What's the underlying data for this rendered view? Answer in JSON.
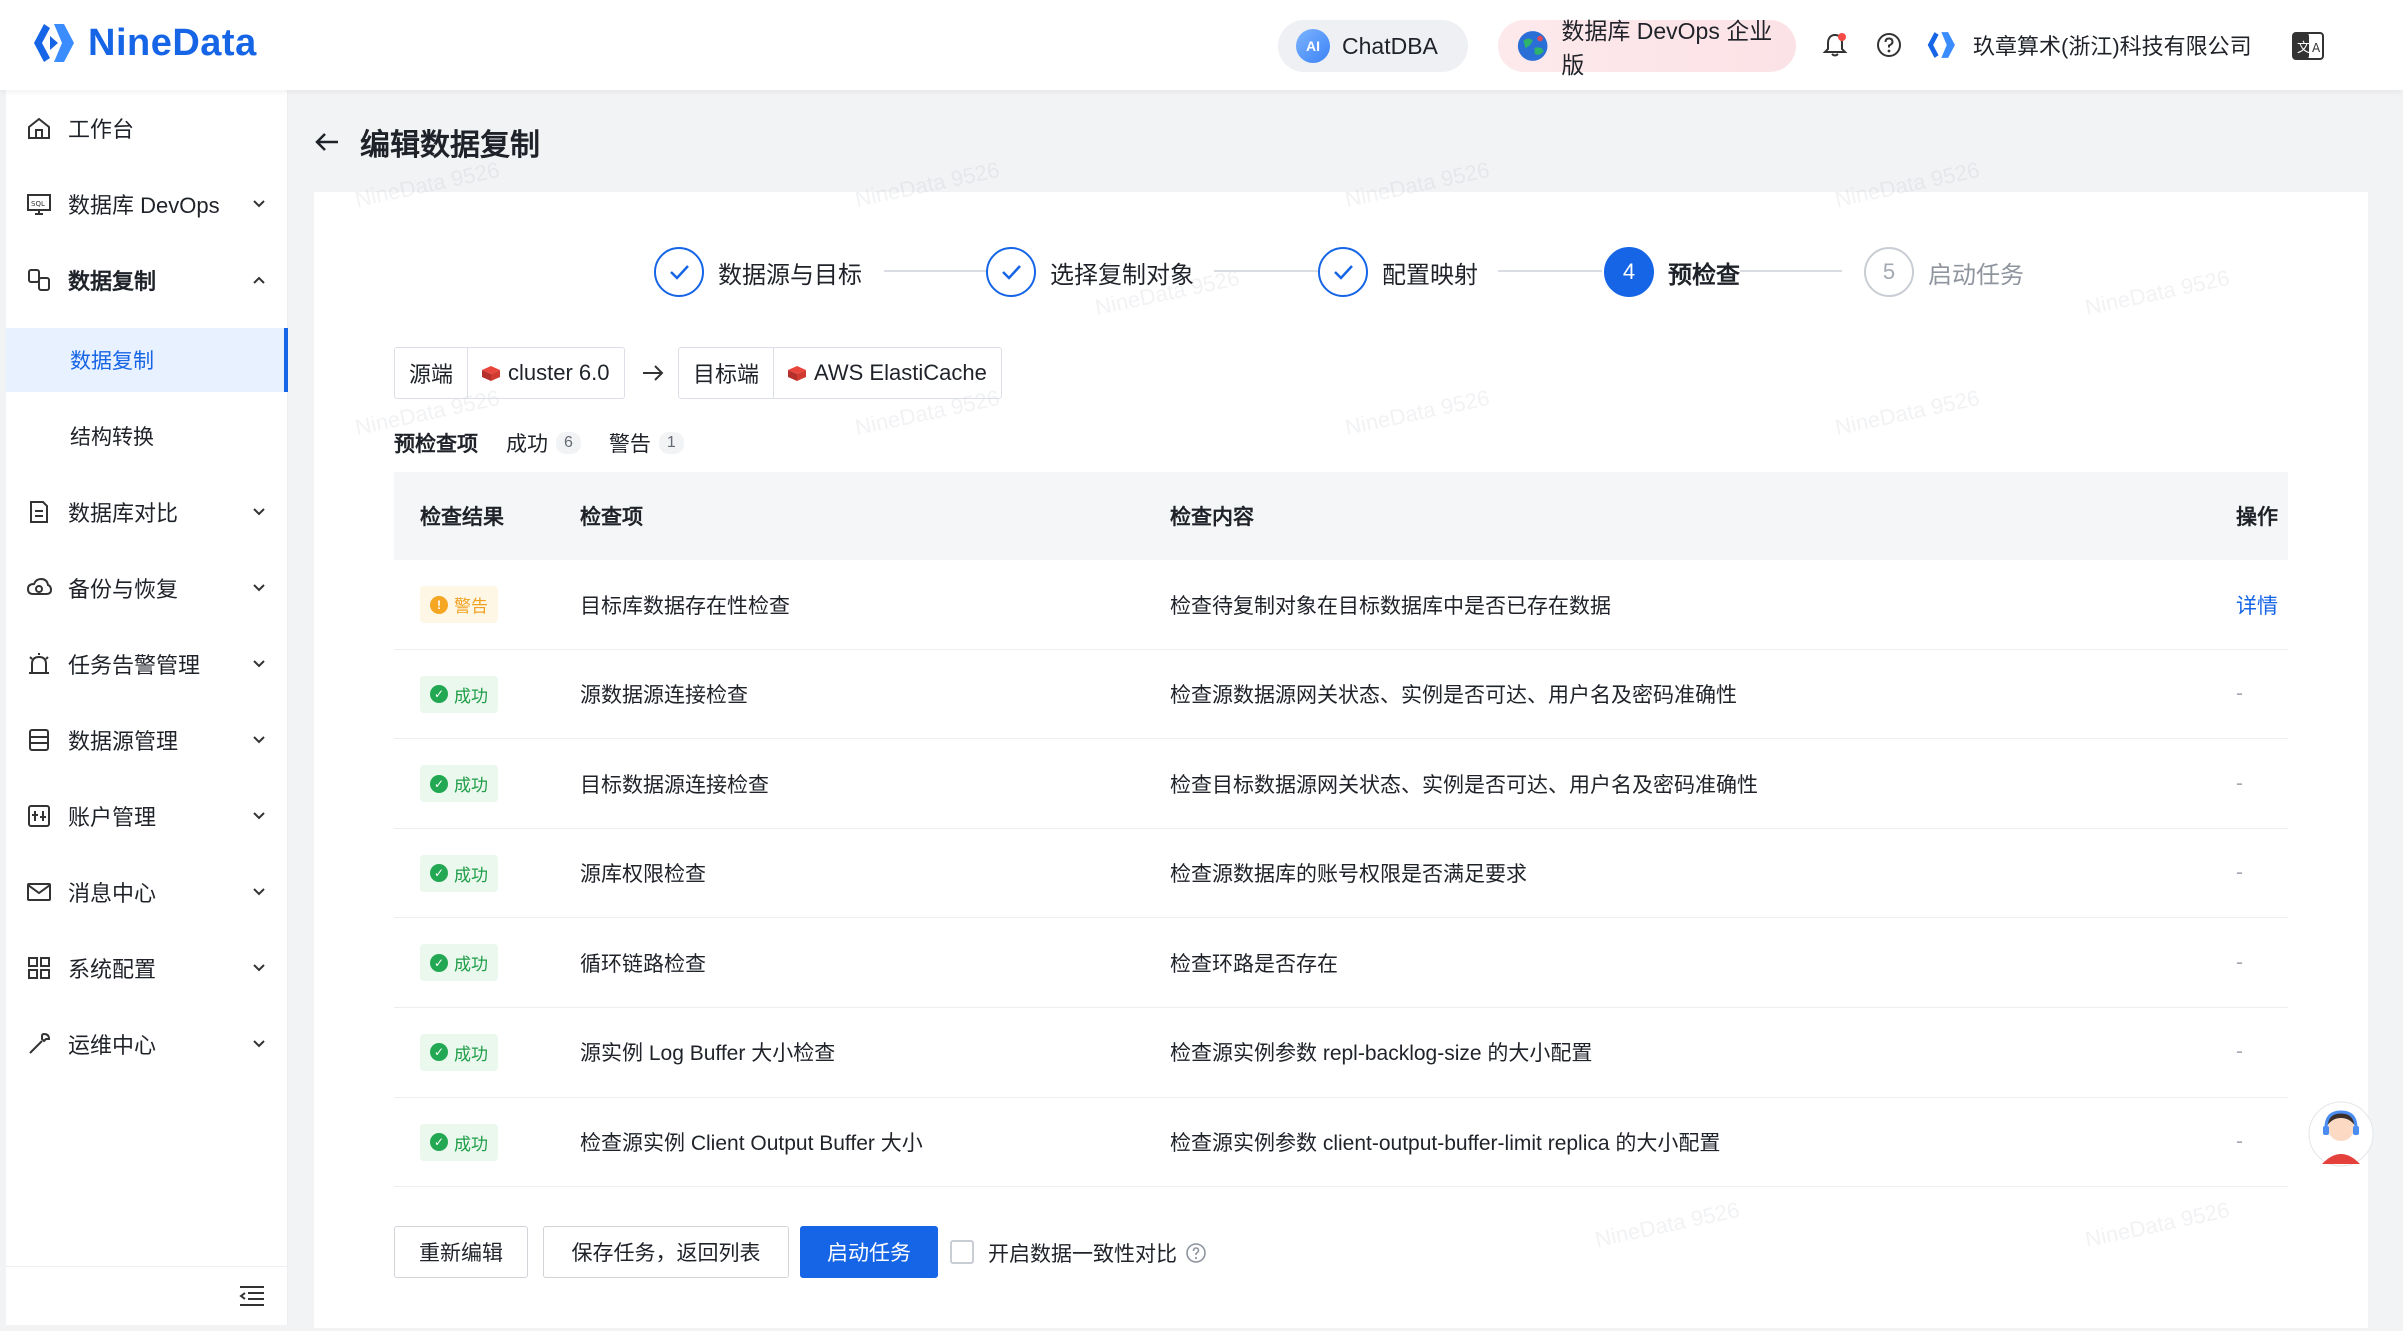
{
  "header": {
    "logo_text": "NineData",
    "chatdba_label": "ChatDBA",
    "chatdba_badge": "AI",
    "edition_label": "数据库 DevOps 企业版",
    "company_name": "玖章算术(浙江)科技有限公司",
    "icons": [
      "bell-icon",
      "help-icon",
      "company-logo-icon",
      "language-switch-icon"
    ]
  },
  "sidebar": {
    "items": [
      {
        "label": "工作台",
        "icon": "home-icon"
      },
      {
        "label": "数据库 DevOps",
        "icon": "sql-console-icon"
      },
      {
        "label": "数据复制",
        "icon": "replication-icon"
      },
      {
        "label": "数据库对比",
        "icon": "compare-icon"
      },
      {
        "label": "备份与恢复",
        "icon": "cloud-backup-icon"
      },
      {
        "label": "任务告警管理",
        "icon": "alarm-icon"
      },
      {
        "label": "数据源管理",
        "icon": "datasource-icon"
      },
      {
        "label": "账户管理",
        "icon": "account-icon"
      },
      {
        "label": "消息中心",
        "icon": "mail-icon"
      },
      {
        "label": "系统配置",
        "icon": "grid-icon"
      },
      {
        "label": "运维中心",
        "icon": "wrench-icon"
      }
    ],
    "sub_items": [
      {
        "label": "数据复制",
        "active": true
      },
      {
        "label": "结构转换",
        "active": false
      }
    ]
  },
  "page": {
    "title": "编辑数据复制",
    "steps": [
      {
        "label": "数据源与目标",
        "state": "done",
        "number": ""
      },
      {
        "label": "选择复制对象",
        "state": "done",
        "number": ""
      },
      {
        "label": "配置映射",
        "state": "done",
        "number": ""
      },
      {
        "label": "预检查",
        "state": "current",
        "number": "4"
      },
      {
        "label": "启动任务",
        "state": "pending",
        "number": "5"
      }
    ],
    "source": {
      "tag": "源端",
      "value": "cluster 6.0"
    },
    "target": {
      "tag": "目标端",
      "value": "AWS ElastiCache"
    },
    "filters": [
      {
        "label": "预检查项",
        "count": ""
      },
      {
        "label": "成功",
        "count": "6"
      },
      {
        "label": "警告",
        "count": "1"
      }
    ],
    "table": {
      "headers": [
        "检查结果",
        "检查项",
        "检查内容",
        "操作"
      ],
      "rows": [
        {
          "status": "警告",
          "status_type": "warn",
          "item": "目标库数据存在性检查",
          "content": "检查待复制对象在目标数据库中是否已存在数据",
          "op": "详情"
        },
        {
          "status": "成功",
          "status_type": "ok",
          "item": "源数据源连接检查",
          "content": "检查源数据源网关状态、实例是否可达、用户名及密码准确性",
          "op": "-"
        },
        {
          "status": "成功",
          "status_type": "ok",
          "item": "目标数据源连接检查",
          "content": "检查目标数据源网关状态、实例是否可达、用户名及密码准确性",
          "op": "-"
        },
        {
          "status": "成功",
          "status_type": "ok",
          "item": "源库权限检查",
          "content": "检查源数据库的账号权限是否满足要求",
          "op": "-"
        },
        {
          "status": "成功",
          "status_type": "ok",
          "item": "循环链路检查",
          "content": "检查环路是否存在",
          "op": "-"
        },
        {
          "status": "成功",
          "status_type": "ok",
          "item": "源实例 Log Buffer 大小检查",
          "content": "检查源实例参数 repl-backlog-size 的大小配置",
          "op": "-"
        },
        {
          "status": "成功",
          "status_type": "ok",
          "item": "检查源实例 Client Output Buffer 大小",
          "content": "检查源实例参数 client-output-buffer-limit replica 的大小配置",
          "op": "-"
        }
      ]
    },
    "buttons": {
      "re_edit": "重新编辑",
      "save_return": "保存任务，返回列表",
      "start": "启动任务"
    },
    "consistency_checkbox": {
      "label": "开启数据一致性对比",
      "checked": false
    },
    "watermark": "NineData 9526"
  },
  "colors": {
    "brand": "#1665e6",
    "success": "#22a852",
    "warning": "#f5a623"
  }
}
